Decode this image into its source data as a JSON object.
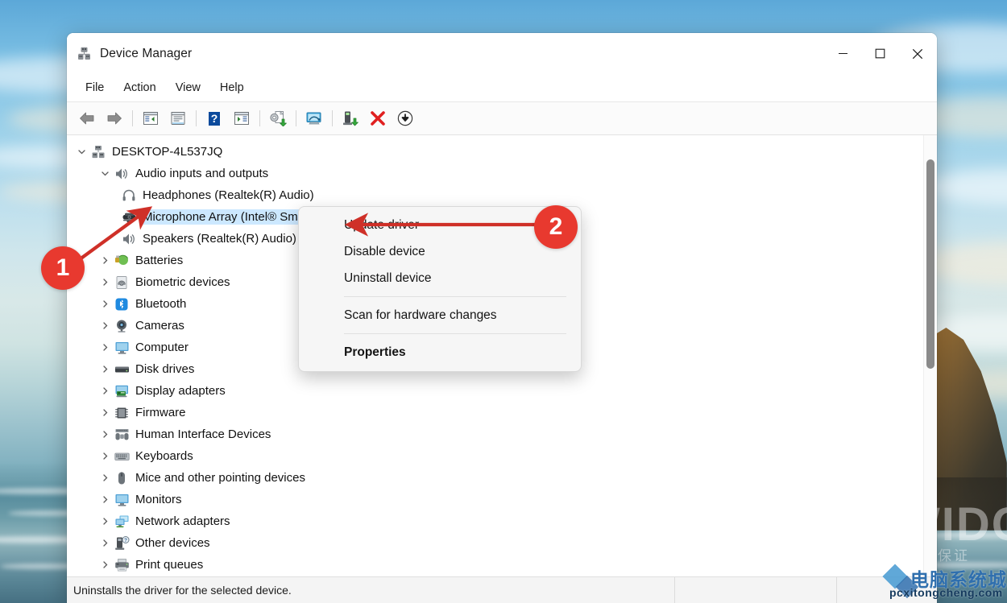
{
  "window": {
    "title": "Device Manager",
    "title_icon": "device-manager-icon",
    "controls": {
      "minimize": "minimize-icon",
      "maximize": "maximize-icon",
      "close": "close-icon"
    }
  },
  "menubar": {
    "items": [
      {
        "label": "File"
      },
      {
        "label": "Action"
      },
      {
        "label": "View"
      },
      {
        "label": "Help"
      }
    ]
  },
  "toolbar": {
    "buttons": [
      {
        "name": "back-icon",
        "tooltip": "Back"
      },
      {
        "name": "forward-icon",
        "tooltip": "Forward"
      },
      {
        "name": "show-hide-console-tree-icon",
        "tooltip": "Show/Hide Console Tree"
      },
      {
        "name": "properties-icon",
        "tooltip": "Properties"
      },
      {
        "name": "help-icon",
        "tooltip": "Help"
      },
      {
        "name": "show-hide-action-pane-icon",
        "tooltip": "Show/Hide Action Pane"
      },
      {
        "name": "update-driver-icon",
        "tooltip": "Update Driver Software"
      },
      {
        "name": "scan-for-hardware-changes-icon",
        "tooltip": "Scan for hardware changes"
      },
      {
        "name": "enable-device-icon",
        "tooltip": "Enable device"
      },
      {
        "name": "uninstall-device-icon",
        "tooltip": "Uninstall device"
      },
      {
        "name": "disable-device-icon",
        "tooltip": "Disable device"
      }
    ]
  },
  "tree": {
    "nodes": [
      {
        "label": "DESKTOP-4L537JQ",
        "depth": 0,
        "expander": "down",
        "icon": "computer-root-icon",
        "selected": false
      },
      {
        "label": "Audio inputs and outputs",
        "depth": 1,
        "expander": "down",
        "icon": "speaker-icon",
        "selected": false
      },
      {
        "label": "Headphones (Realtek(R) Audio)",
        "depth": 2,
        "expander": "none",
        "icon": "headphones-icon",
        "selected": false
      },
      {
        "label": "Microphone Array (Intel® Smart Sound Technology for Digital Microphones)",
        "depth": 2,
        "expander": "none",
        "icon": "microphone-array-icon",
        "selected": true
      },
      {
        "label": "Speakers (Realtek(R) Audio)",
        "depth": 2,
        "expander": "none",
        "icon": "speaker-icon",
        "selected": false
      },
      {
        "label": "Batteries",
        "depth": 1,
        "expander": "right",
        "icon": "battery-icon",
        "selected": false
      },
      {
        "label": "Biometric devices",
        "depth": 1,
        "expander": "right",
        "icon": "fingerprint-icon",
        "selected": false
      },
      {
        "label": "Bluetooth",
        "depth": 1,
        "expander": "right",
        "icon": "bluetooth-icon",
        "selected": false
      },
      {
        "label": "Cameras",
        "depth": 1,
        "expander": "right",
        "icon": "camera-icon",
        "selected": false
      },
      {
        "label": "Computer",
        "depth": 1,
        "expander": "right",
        "icon": "monitor-icon",
        "selected": false
      },
      {
        "label": "Disk drives",
        "depth": 1,
        "expander": "right",
        "icon": "disk-drive-icon",
        "selected": false
      },
      {
        "label": "Display adapters",
        "depth": 1,
        "expander": "right",
        "icon": "display-adapter-icon",
        "selected": false
      },
      {
        "label": "Firmware",
        "depth": 1,
        "expander": "right",
        "icon": "firmware-chip-icon",
        "selected": false
      },
      {
        "label": "Human Interface Devices",
        "depth": 1,
        "expander": "right",
        "icon": "hid-icon",
        "selected": false
      },
      {
        "label": "Keyboards",
        "depth": 1,
        "expander": "right",
        "icon": "keyboard-icon",
        "selected": false
      },
      {
        "label": "Mice and other pointing devices",
        "depth": 1,
        "expander": "right",
        "icon": "mouse-icon",
        "selected": false
      },
      {
        "label": "Monitors",
        "depth": 1,
        "expander": "right",
        "icon": "monitor-icon",
        "selected": false
      },
      {
        "label": "Network adapters",
        "depth": 1,
        "expander": "right",
        "icon": "network-adapter-icon",
        "selected": false
      },
      {
        "label": "Other devices",
        "depth": 1,
        "expander": "right",
        "icon": "other-device-icon",
        "selected": false
      },
      {
        "label": "Print queues",
        "depth": 1,
        "expander": "right",
        "icon": "printer-icon",
        "selected": false
      }
    ]
  },
  "context_menu": {
    "items": [
      {
        "label": "Update driver",
        "bold": false,
        "separator_after": false
      },
      {
        "label": "Disable device",
        "bold": false,
        "separator_after": false
      },
      {
        "label": "Uninstall device",
        "bold": false,
        "separator_after": true
      },
      {
        "label": "Scan for hardware changes",
        "bold": false,
        "separator_after": true
      },
      {
        "label": "Properties",
        "bold": true,
        "separator_after": false
      }
    ]
  },
  "statusbar": {
    "message": "Uninstalls the driver for the selected device.",
    "cell2": "",
    "cell3": ""
  },
  "annotations": {
    "badges": [
      {
        "label": "1",
        "target": "microphone-array-tree-item"
      },
      {
        "label": "2",
        "target": "update-driver-menu-item"
      }
    ],
    "accent_color": "#e8392f"
  },
  "watermarks": {
    "wallpaper_main": "WIDC",
    "wallpaper_sub": "品质保证",
    "corner_cn": "电脑系统城",
    "corner_url": "pcxitongcheng.com"
  }
}
